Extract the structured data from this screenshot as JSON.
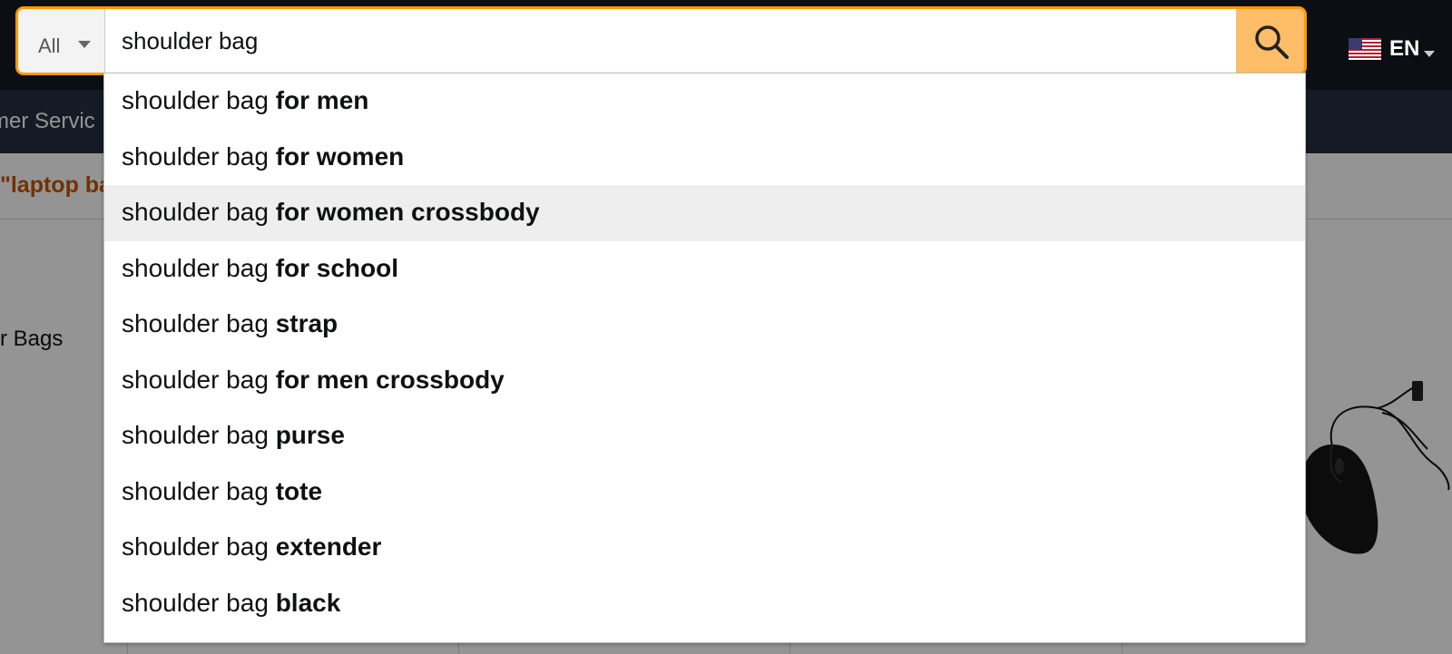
{
  "search": {
    "department": "All",
    "query": "shoulder bag"
  },
  "language": {
    "label": "EN"
  },
  "background": {
    "nav_text": "mer Servic",
    "promo_text": "\"laptop ba",
    "category_text": "r Bags"
  },
  "suggestions": [
    {
      "prefix": "shoulder bag",
      "completion": "for men"
    },
    {
      "prefix": "shoulder bag",
      "completion": "for women"
    },
    {
      "prefix": "shoulder bag",
      "completion": "for women crossbody"
    },
    {
      "prefix": "shoulder bag",
      "completion": "for school"
    },
    {
      "prefix": "shoulder bag",
      "completion": "strap"
    },
    {
      "prefix": "shoulder bag",
      "completion": "for men crossbody"
    },
    {
      "prefix": "shoulder bag",
      "completion": "purse"
    },
    {
      "prefix": "shoulder bag",
      "completion": "tote"
    },
    {
      "prefix": "shoulder bag",
      "completion": "extender"
    },
    {
      "prefix": "shoulder bag",
      "completion": "black"
    }
  ],
  "highlighted_index": 2,
  "colors": {
    "accent": "#ff9900",
    "search_button": "#febd69",
    "header": "#131921",
    "nav": "#232f3e"
  }
}
